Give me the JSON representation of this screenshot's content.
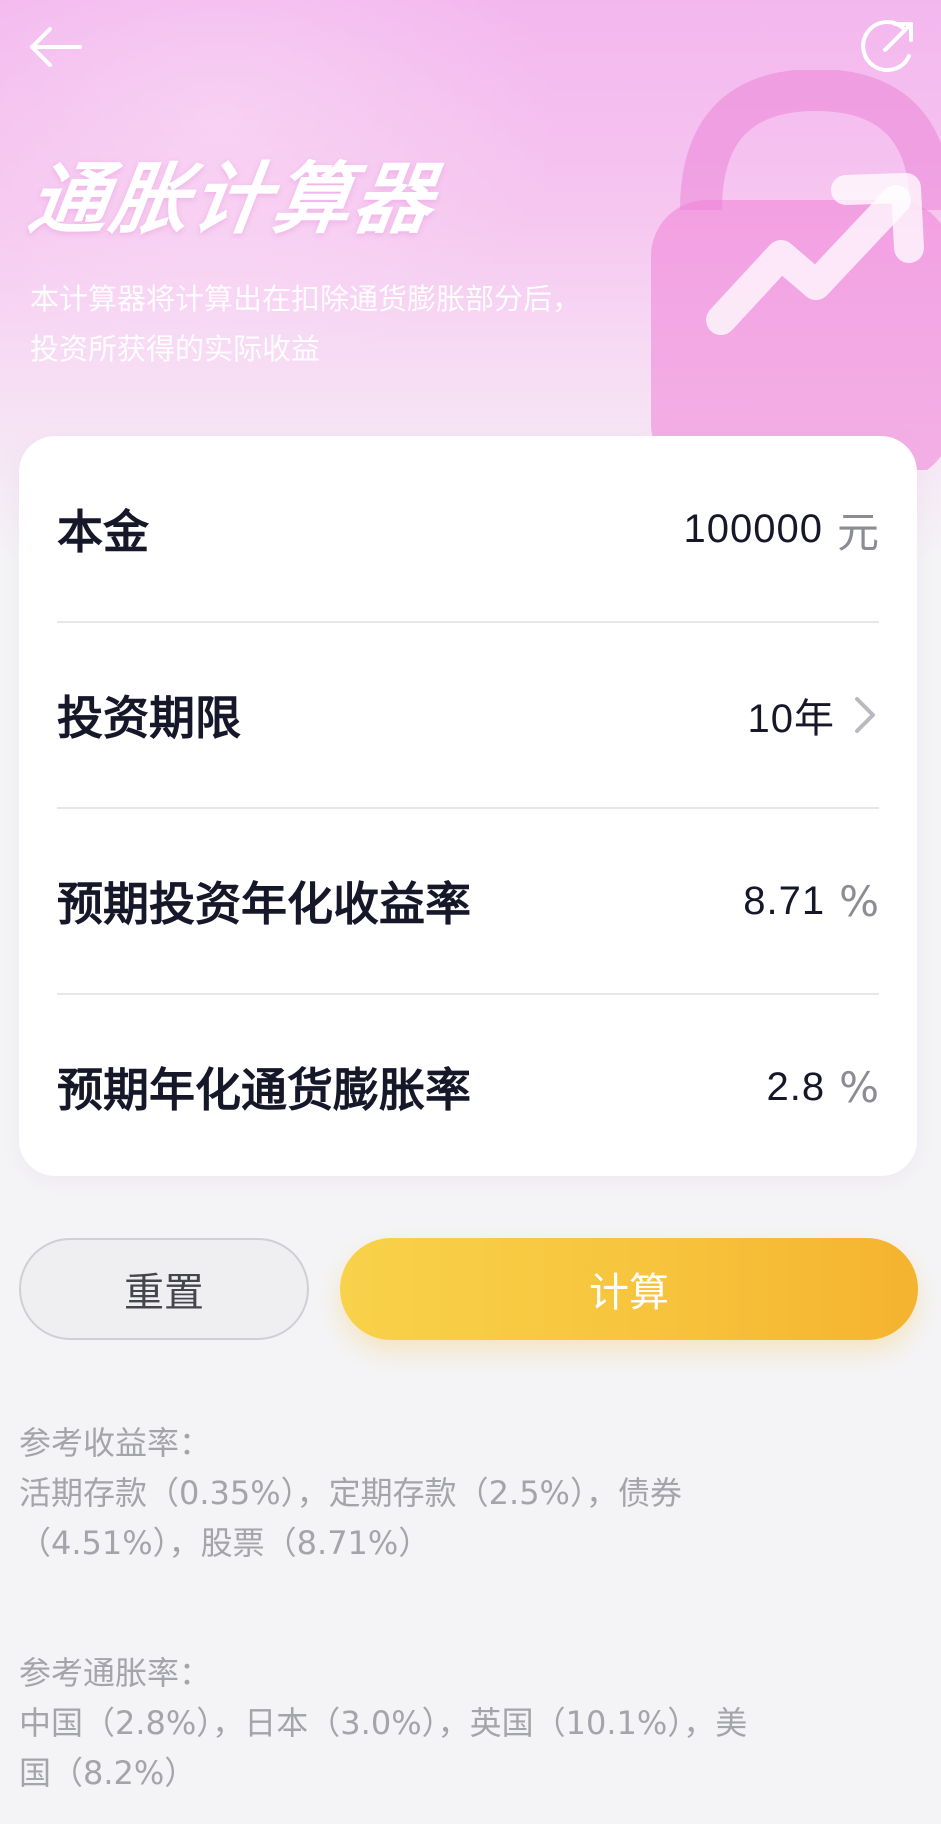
{
  "header": {
    "back_icon": "arrow-left-icon",
    "share_icon": "share-icon",
    "title": "通胀计算器",
    "subtitle_lines": [
      "本计算器将计算出在扣除通货膨胀部分后，",
      "投资所获得的实际收益"
    ]
  },
  "form": {
    "principal": {
      "label": "本金",
      "value": "100000",
      "unit": "元"
    },
    "term": {
      "label": "投资期限",
      "value": "10年",
      "icon": "chevron-right-icon"
    },
    "return_rate": {
      "label": "预期投资年化收益率",
      "value": "8.71",
      "unit": "%"
    },
    "inflation_rate": {
      "label": "预期年化通货膨胀率",
      "value": "2.8",
      "unit": "%"
    }
  },
  "actions": {
    "reset_label": "重置",
    "calculate_label": "计算"
  },
  "references": {
    "returns_title": "参考收益率：",
    "returns_lines": [
      "活期存款（0.35%），定期存款（2.5%），债券",
      "（4.51%），股票（8.71%）"
    ],
    "inflation_title": "参考通胀率：",
    "inflation_lines": [
      "中国（2.8%），日本（3.0%），英国（10.1%），美",
      "国（8.2%）"
    ]
  },
  "colors": {
    "hero_pink": "#f3b7ee",
    "primary_yellow": "#f7c23b",
    "text_dark": "#16182a",
    "text_muted": "#a4a4ab"
  }
}
